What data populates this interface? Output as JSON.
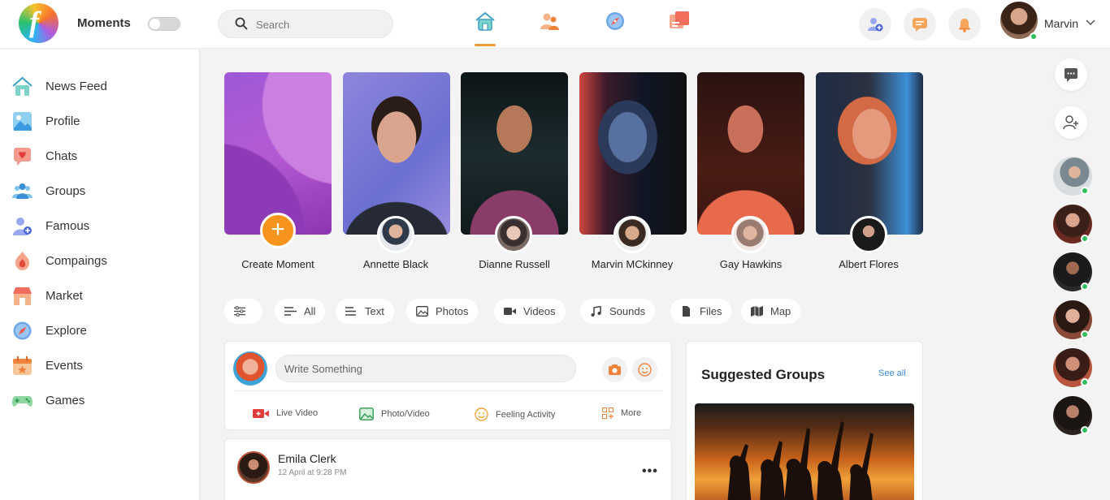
{
  "header": {
    "brand": "Moments",
    "search_placeholder": "Search",
    "user_name": "Marvin"
  },
  "sidebar": {
    "items": [
      {
        "label": "News Feed",
        "icon": "home-icon"
      },
      {
        "label": "Profile",
        "icon": "profile-icon"
      },
      {
        "label": "Chats",
        "icon": "chat-icon"
      },
      {
        "label": "Groups",
        "icon": "groups-icon"
      },
      {
        "label": "Famous",
        "icon": "famous-icon"
      },
      {
        "label": "Compaings",
        "icon": "campaign-icon"
      },
      {
        "label": "Market",
        "icon": "market-icon"
      },
      {
        "label": "Explore",
        "icon": "compass-icon"
      },
      {
        "label": "Events",
        "icon": "calendar-icon"
      },
      {
        "label": "Games",
        "icon": "gamepad-icon"
      }
    ]
  },
  "stories": {
    "create_label": "Create Moment",
    "people": [
      "Annette Black",
      "Dianne Russell",
      "Marvin MCkinney",
      "Gay Hawkins",
      "Albert Flores"
    ]
  },
  "filters": [
    "All",
    "Text",
    "Photos",
    "Videos",
    "Sounds",
    "Files",
    "Map"
  ],
  "composer": {
    "placeholder": "Write Something",
    "actions": [
      "Live Video",
      "Photo/Video",
      "Feeling Activity",
      "More"
    ]
  },
  "post": {
    "author": "Emila Clerk",
    "time": "12 April at 9:28 PM"
  },
  "suggested_groups": {
    "title": "Suggested Groups",
    "see_all": "See all"
  },
  "colors": {
    "accent": "#f7941d",
    "online": "#2fbf5b",
    "link": "#3b8bd6"
  }
}
